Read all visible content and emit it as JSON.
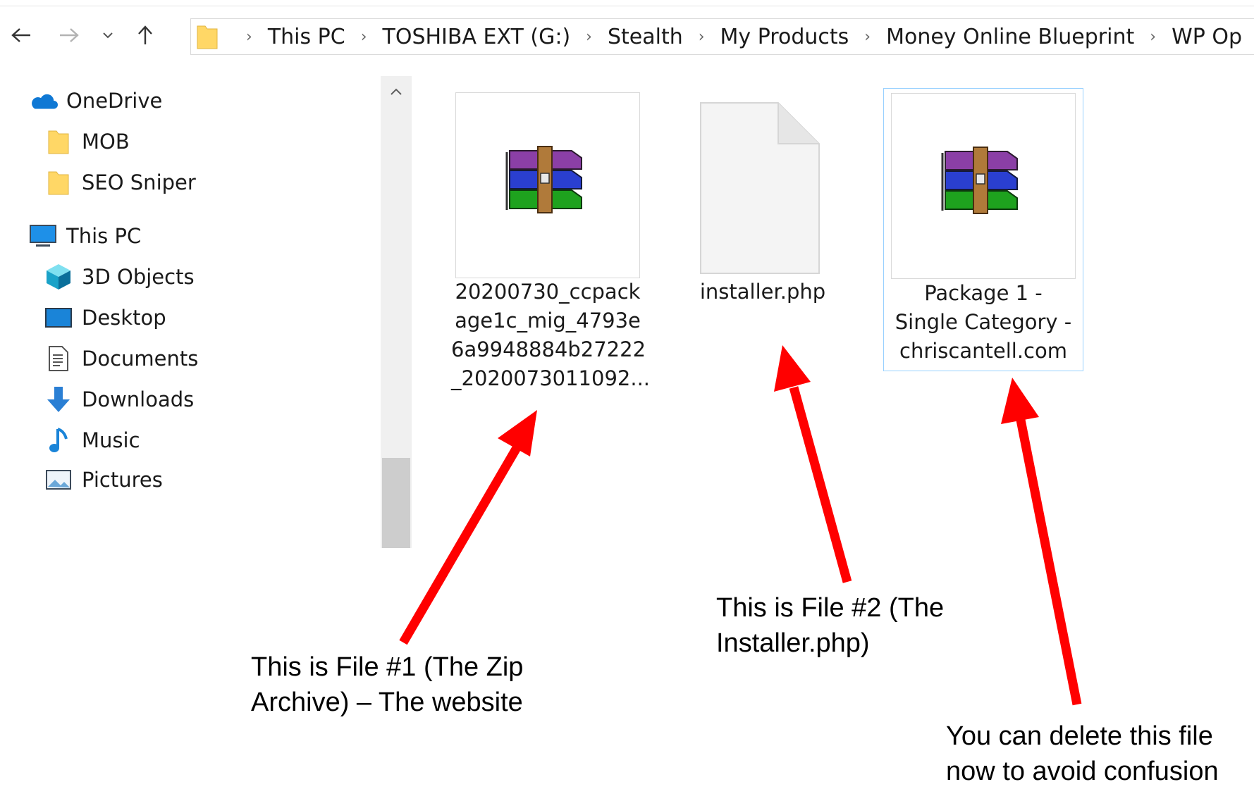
{
  "address_bar": {
    "crumbs": [
      "This PC",
      "TOSHIBA EXT (G:)",
      "Stealth",
      "My Products",
      "Money Online Blueprint",
      "WP Op"
    ]
  },
  "nav_pane": {
    "items": [
      {
        "label": "OneDrive",
        "icon": "cloud-icon"
      },
      {
        "label": "MOB",
        "icon": "folder-icon"
      },
      {
        "label": "SEO Sniper",
        "icon": "folder-icon"
      },
      {
        "label": "This PC",
        "icon": "computer-icon"
      },
      {
        "label": "3D Objects",
        "icon": "cube-icon"
      },
      {
        "label": "Desktop",
        "icon": "desktop-icon"
      },
      {
        "label": "Documents",
        "icon": "document-icon"
      },
      {
        "label": "Downloads",
        "icon": "download-arrow-icon"
      },
      {
        "label": "Music",
        "icon": "music-note-icon"
      },
      {
        "label": "Pictures",
        "icon": "pictures-icon"
      }
    ]
  },
  "files": [
    {
      "name_lines": [
        "20200730_ccpack",
        "age1c_mig_4793e",
        "6a9948884b27222",
        "_2020073011092..."
      ],
      "icon": "winrar-archive-icon"
    },
    {
      "name_lines": [
        "installer.php"
      ],
      "icon": "blank-file-icon"
    },
    {
      "name_lines": [
        "Package 1 -",
        "Single Category -",
        "chriscantell.com"
      ],
      "icon": "winrar-archive-icon"
    }
  ],
  "annotations": {
    "file1": [
      "This is File #1 (The Zip",
      "Archive) – The website"
    ],
    "file2": [
      "This is File #2 (The",
      "Installer.php)"
    ],
    "delete": [
      "You can delete this file",
      "now to avoid confusion"
    ],
    "arrow_color": "#ff0000"
  }
}
